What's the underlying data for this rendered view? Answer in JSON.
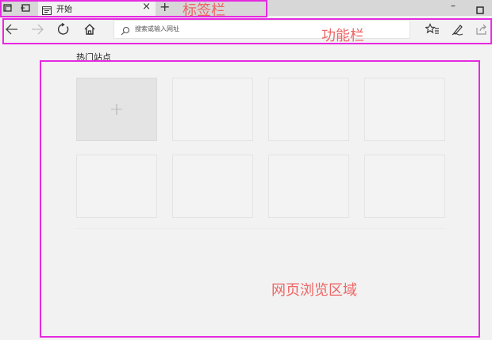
{
  "tab_bar": {
    "active_tab": {
      "title": "开始",
      "close": "×"
    },
    "new_tab": "+",
    "window": {
      "minimize": "–"
    }
  },
  "toolbar": {
    "address_placeholder": "搜索或输入网址"
  },
  "annotations": {
    "tab_bar_label": "标签栏",
    "toolbar_label": "功能栏",
    "content_label": "网页浏览区域"
  },
  "content": {
    "top_sites_title": "热门站点",
    "add_tile_symbol": "+"
  },
  "colors": {
    "annotation_box": "#e52ae0",
    "annotation_text": "#ef6464",
    "tab_bar_bg": "#d7d7d7",
    "page_bg": "#f2f2f2"
  },
  "icons": [
    "tabs-aside-icon",
    "back-tabs-icon",
    "page-icon",
    "back-icon",
    "forward-icon",
    "refresh-icon",
    "home-icon",
    "search-icon",
    "favorites-icon",
    "pen-icon",
    "share-icon",
    "maximize-icon"
  ]
}
